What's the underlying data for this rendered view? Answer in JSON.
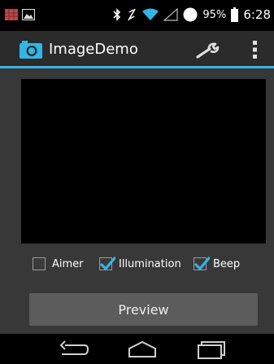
{
  "status_bar": {
    "battery_percent": "95%",
    "time": "6:28",
    "icons": [
      "notification-flag-icon",
      "gallery-icon",
      "bluetooth-icon",
      "nfc-icon",
      "wifi-icon",
      "cell-signal-icon",
      "data-indicator-icon",
      "battery-icon"
    ]
  },
  "action_bar": {
    "title": "ImageDemo",
    "icons": [
      "camera-icon",
      "wrench-icon",
      "overflow-menu-icon"
    ],
    "accent": "#33b5e5"
  },
  "options": [
    {
      "label": "Aimer",
      "checked": false
    },
    {
      "label": "Illumination",
      "checked": true
    },
    {
      "label": "Beep",
      "checked": true
    }
  ],
  "preview_button": {
    "label": "Preview"
  },
  "nav_bar": {
    "icons": [
      "back-icon",
      "home-icon",
      "recents-icon"
    ]
  }
}
